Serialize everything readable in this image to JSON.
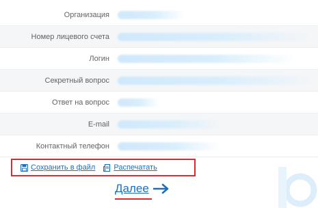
{
  "fields": [
    {
      "label": "Организация"
    },
    {
      "label": "Номер лицевого счета"
    },
    {
      "label": "Логин"
    },
    {
      "label": "Секретный вопрос"
    },
    {
      "label": "Ответ на вопрос"
    },
    {
      "label": "E-mail"
    },
    {
      "label": "Контактный телефон"
    }
  ],
  "actions": {
    "save_label": "Сохранить в файл",
    "print_label": "Распечатать"
  },
  "next_label": "Далее",
  "colors": {
    "link": "#1a6fc2",
    "highlight": "#e3262c",
    "blurred_value": "#cfe8fb"
  }
}
